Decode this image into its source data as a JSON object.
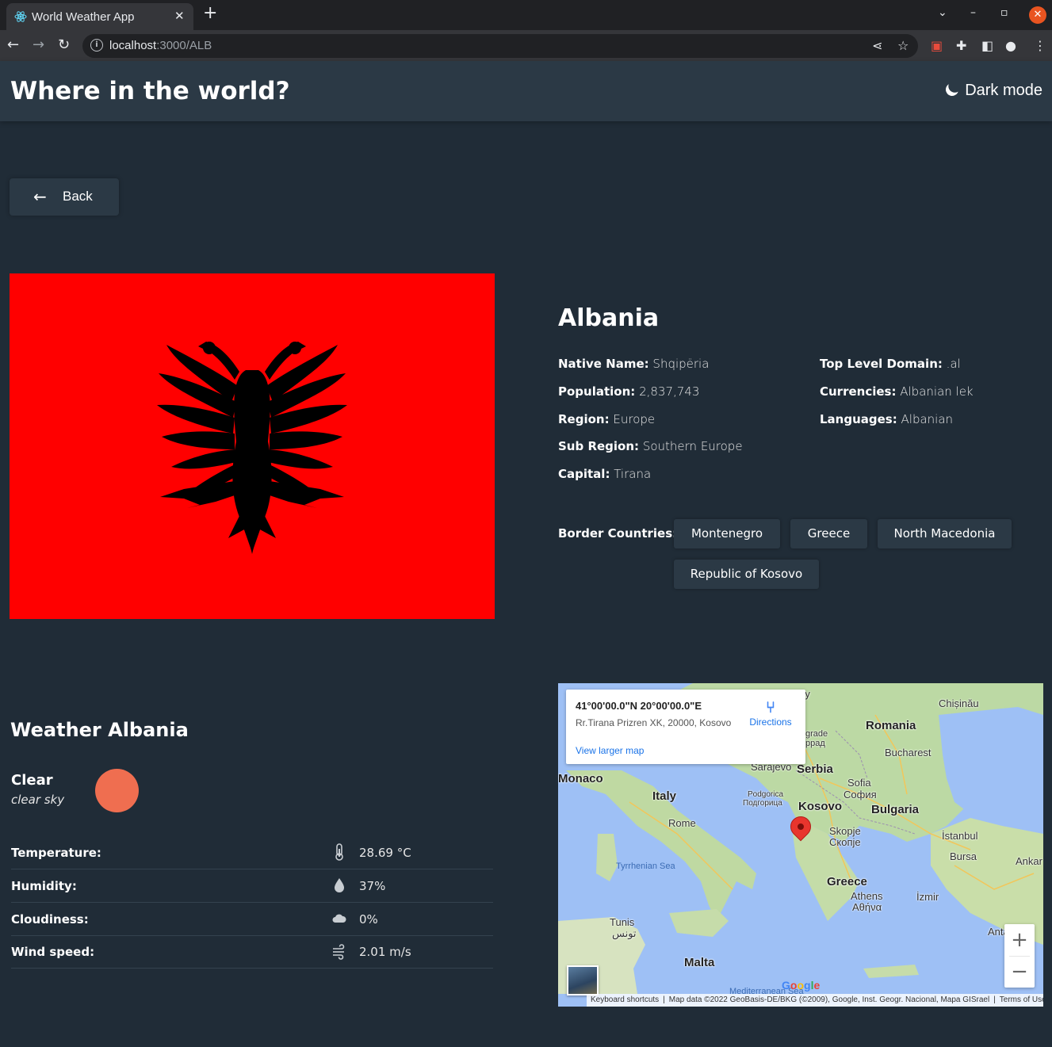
{
  "browser": {
    "tab_title": "World Weather App",
    "tab_close": "✕",
    "new_tab": "+",
    "url_host": "localhost",
    "url_path": ":3000/ALB"
  },
  "header": {
    "title": "Where in the world?",
    "dark_mode_label": "Dark mode"
  },
  "back_button": {
    "label": "Back"
  },
  "country": {
    "name": "Albania",
    "flag_color": "#ff0000",
    "left_fields": [
      {
        "label": "Native Name:",
        "value": "Shqipëria"
      },
      {
        "label": "Population:",
        "value": "2,837,743"
      },
      {
        "label": "Region:",
        "value": "Europe"
      },
      {
        "label": "Sub Region:",
        "value": "Southern Europe"
      },
      {
        "label": "Capital:",
        "value": "Tirana"
      }
    ],
    "right_fields": [
      {
        "label": "Top Level Domain:",
        "value": ".al"
      },
      {
        "label": "Currencies:",
        "value": "Albanian lek"
      },
      {
        "label": "Languages:",
        "value": "Albanian"
      }
    ],
    "border_label": "Border Countries:",
    "border_countries": [
      "Montenegro",
      "Greece",
      "North Macedonia",
      "Republic of Kosovo"
    ]
  },
  "weather": {
    "title": "Weather Albania",
    "main": "Clear",
    "description": "clear sky",
    "sun_color": "#ef6e50",
    "rows": [
      {
        "label": "Temperature:",
        "icon": "thermometer-icon",
        "value": "28.69 °C"
      },
      {
        "label": "Humidity:",
        "icon": "droplet-icon",
        "value": "37%"
      },
      {
        "label": "Cloudiness:",
        "icon": "cloud-icon",
        "value": "0%"
      },
      {
        "label": "Wind speed:",
        "icon": "wind-icon",
        "value": "2.01 m/s"
      }
    ]
  },
  "map": {
    "coords": "41°00'00.0\"N 20°00'00.0\"E",
    "address": "Rr.Tirana Prizren XK, 20000, Kosovo",
    "directions": "Directions",
    "view_larger": "View larger map",
    "zoom_in": "+",
    "zoom_out": "−",
    "google": "Google",
    "footer": {
      "shortcuts": "Keyboard shortcuts",
      "data": "Map data ©2022 GeoBasis-DE/BKG (©2009), Google, Inst. Geogr. Nacional, Mapa GISrael",
      "terms": "Terms of Use"
    },
    "labels": {
      "romania": "Romania",
      "chisinau": "Chișinău",
      "bucharest": "Bucharest",
      "belgrade": "grade",
      "belgrade_cyr": "ррад",
      "sarajevo": "Sarajevo",
      "serbia": "Serbia",
      "sofia": "Sofia",
      "sofia_cyr": "София",
      "bulgaria": "Bulgaria",
      "monaco": "Monaco",
      "italy": "Italy",
      "podgorica": "Podgorica",
      "podgorica_cyr": "Подгорица",
      "kosovo": "Kosovo",
      "rome": "Rome",
      "skopje": "Skopje",
      "skopje_cyr": "Скопје",
      "istanbul": "İstanbul",
      "bursa": "Bursa",
      "ankara": "Ankar",
      "tyrrhenian": "Tyrrhenian Sea",
      "greece": "Greece",
      "athens": "Athens",
      "athens_gr": "Αθήνα",
      "izmir": "İzmir",
      "tunis": "Tunis",
      "tunis_ar": "تونس",
      "antalya": "Antaly",
      "malta": "Malta",
      "mediterranean": "Mediterranean Sea",
      "top_fragment": "ry"
    }
  }
}
